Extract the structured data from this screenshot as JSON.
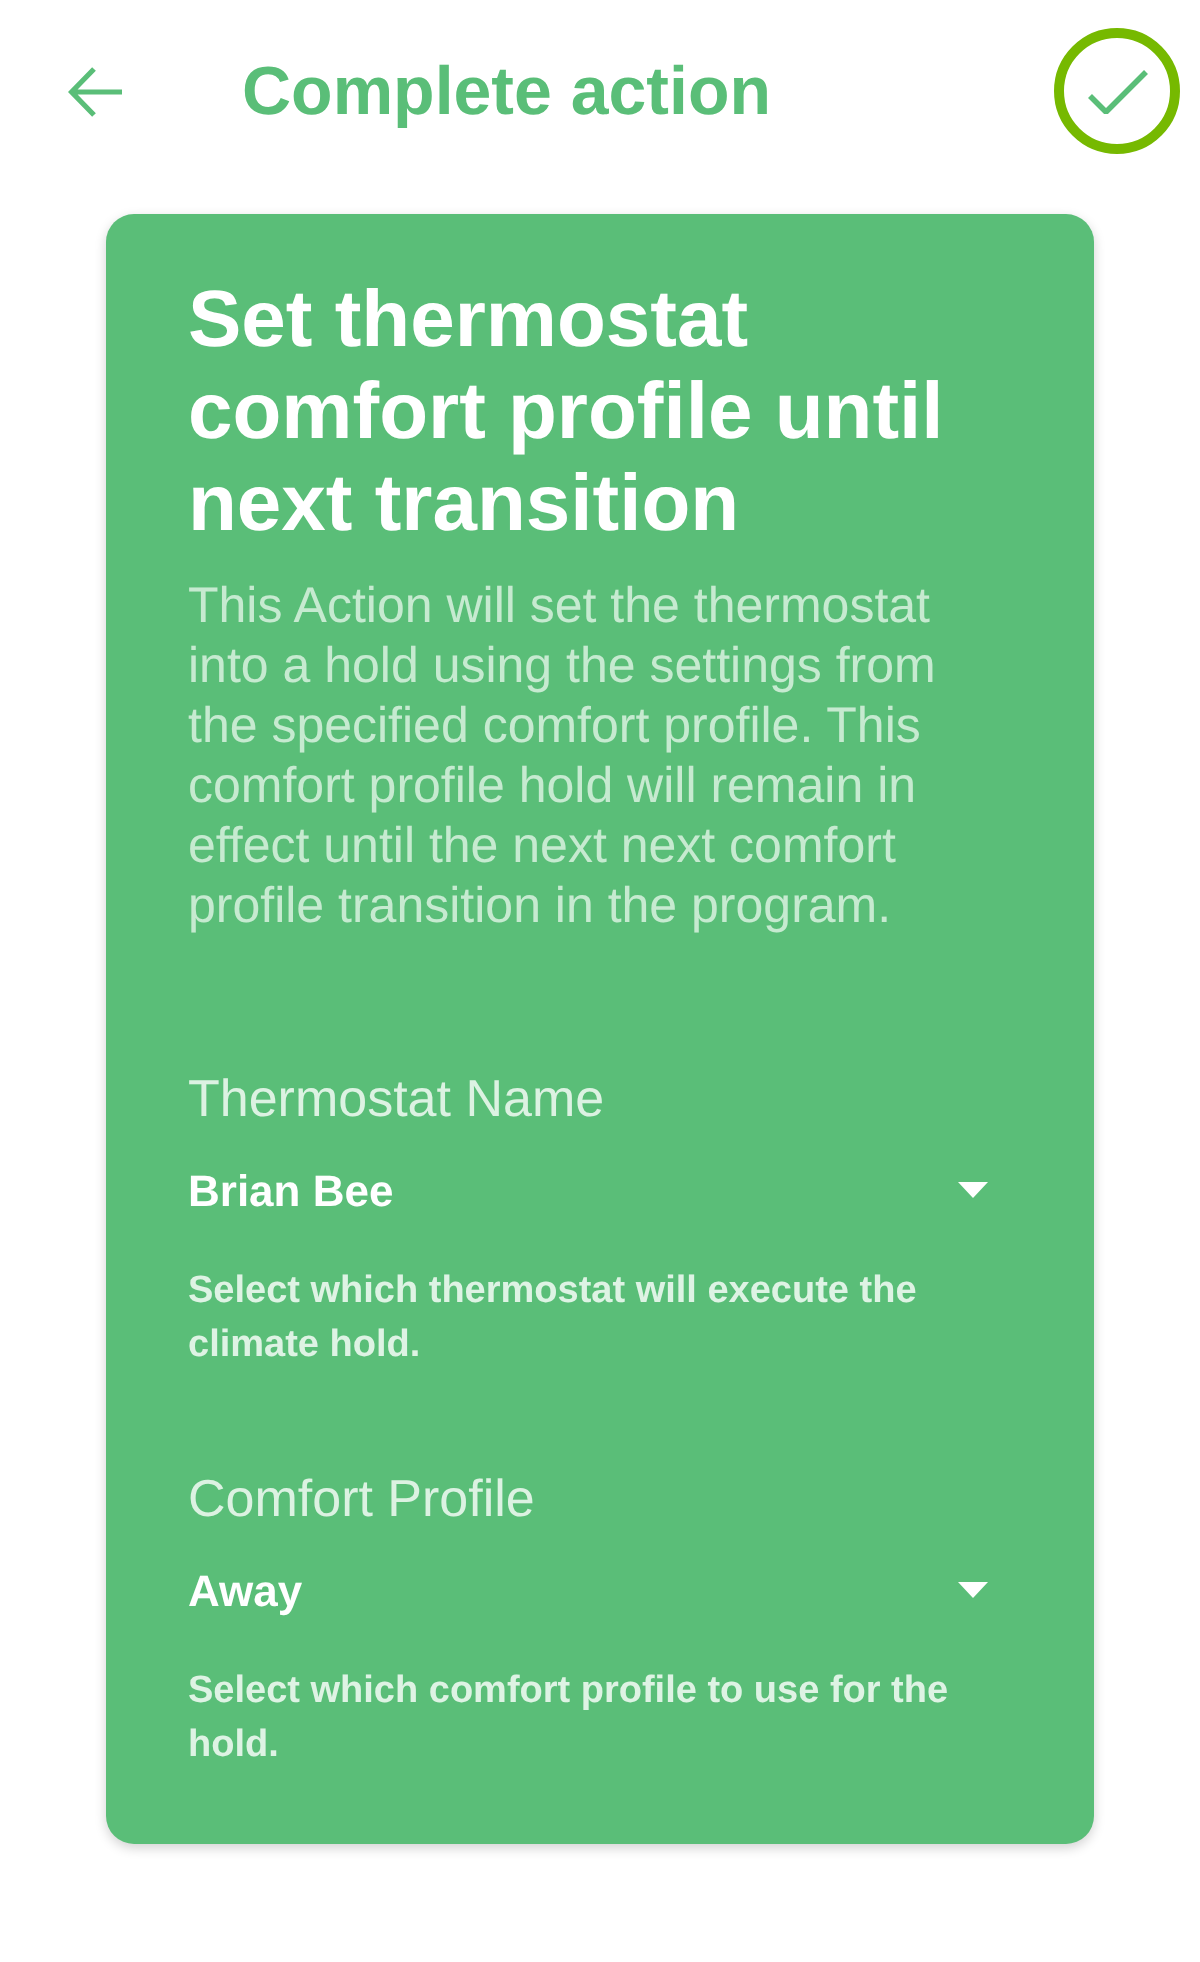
{
  "header": {
    "title": "Complete action"
  },
  "action": {
    "title": "Set thermostat comfort profile until next transition",
    "description": "This Action will set the thermostat into a hold using the settings from the specified comfort profile. This comfort profile hold will remain in effect until the next next comfort profile transition in the program."
  },
  "fields": [
    {
      "label": "Thermostat Name",
      "value": "Brian Bee",
      "help": "Select which thermostat will execute the climate hold."
    },
    {
      "label": "Comfort Profile",
      "value": "Away",
      "help": "Select which comfort profile to use for the hold."
    }
  ]
}
